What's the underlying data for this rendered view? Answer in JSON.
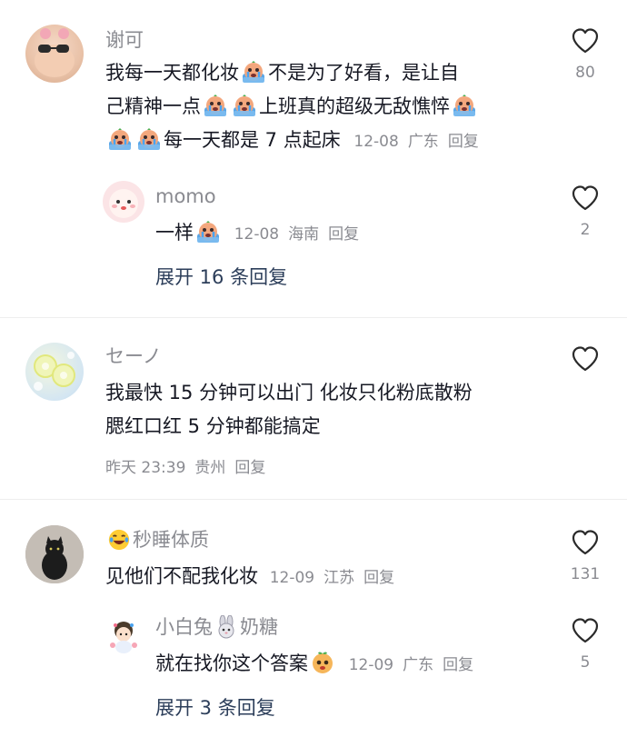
{
  "comments": [
    {
      "username": "谢可",
      "text_line1_a": "我每一天都化妆",
      "text_line1_b": "不是为了好看，是让自",
      "text_line2_a": "己精神一点",
      "text_line2_b": "上班真的超级无敌憔悴",
      "text_line3_a": "每一天都是 7 点起床",
      "date": "12-08",
      "location": "广东",
      "reply": "回复",
      "likes": "80",
      "emoji_icon": "crying-face-emoji",
      "replies": [
        {
          "username": "momo",
          "text": "一样",
          "date": "12-08",
          "location": "海南",
          "reply": "回复",
          "likes": "2"
        }
      ],
      "expand_label": "展开 16 条回复"
    },
    {
      "username": "セーノ",
      "text_line1": "我最快 15 分钟可以出门 化妆只化粉底散粉",
      "text_line2": "腮红口红 5 分钟都能搞定",
      "date": "昨天 23:39",
      "location": "贵州",
      "reply": "回复"
    },
    {
      "username": "秒睡体质",
      "username_emoji": "laughing-tears-emoji",
      "text": "见他们不配我化妆",
      "date": "12-09",
      "location": "江苏",
      "reply": "回复",
      "likes": "131",
      "replies": [
        {
          "username": "小白兔",
          "username_suffix": "奶糖",
          "text": "就在找你这个答案",
          "date": "12-09",
          "location": "广东",
          "reply": "回复",
          "likes": "5"
        }
      ],
      "expand_label": "展开 3 条回复"
    }
  ],
  "colors": {
    "text": "#161823",
    "meta": "#8a8b91",
    "expand": "#2c3e5a",
    "divider": "#eeeeee"
  }
}
